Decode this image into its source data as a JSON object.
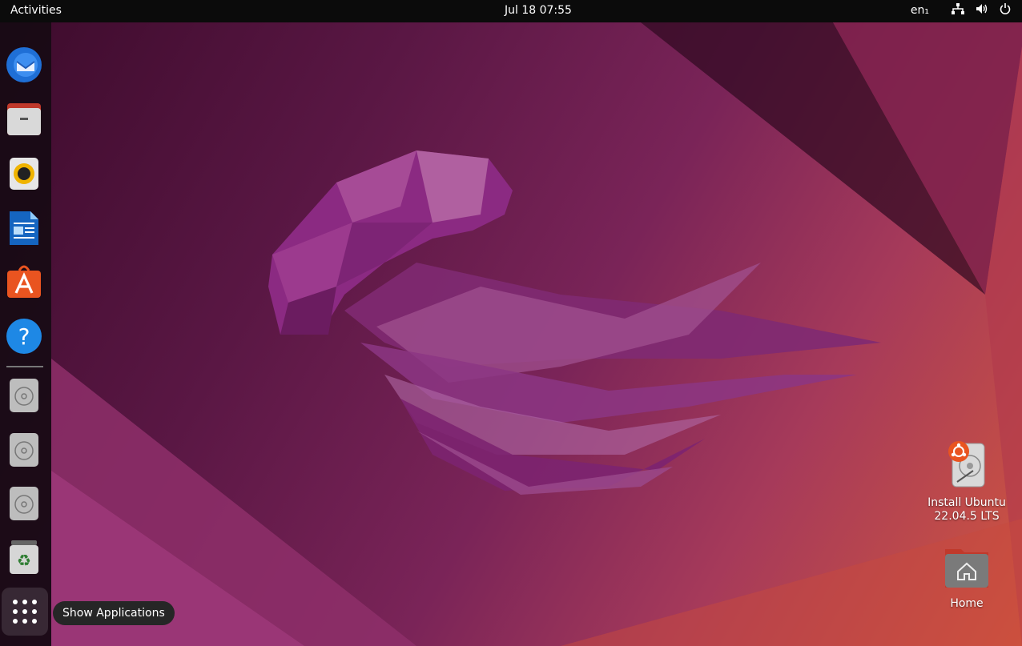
{
  "topbar": {
    "activities": "Activities",
    "clock": "Jul 18  07:55",
    "lang": "en₁"
  },
  "dock": {
    "items": [
      {
        "name": "thunderbird",
        "icon": "thunderbird-mail-icon"
      },
      {
        "name": "files",
        "icon": "files-folder-icon"
      },
      {
        "name": "rhythmbox",
        "icon": "rhythmbox-speaker-icon"
      },
      {
        "name": "libreoffice-writer",
        "icon": "writer-document-icon"
      },
      {
        "name": "ubuntu-software",
        "icon": "software-store-icon"
      },
      {
        "name": "help",
        "icon": "help-question-icon"
      },
      {
        "name": "disc-1",
        "icon": "optical-disc-icon"
      },
      {
        "name": "disc-2",
        "icon": "optical-disc-icon"
      },
      {
        "name": "disc-3",
        "icon": "optical-disc-icon"
      },
      {
        "name": "trash",
        "icon": "trash-recycle-icon"
      }
    ],
    "show_apps_tooltip": "Show Applications"
  },
  "desktop": {
    "install_label_1": "Install Ubuntu",
    "install_label_2": "22.04.5 LTS",
    "home_label": "Home"
  },
  "colors": {
    "accent": "#e95420",
    "topbar": "#0b0b0b",
    "jellyfish": "#8a2f7e"
  }
}
